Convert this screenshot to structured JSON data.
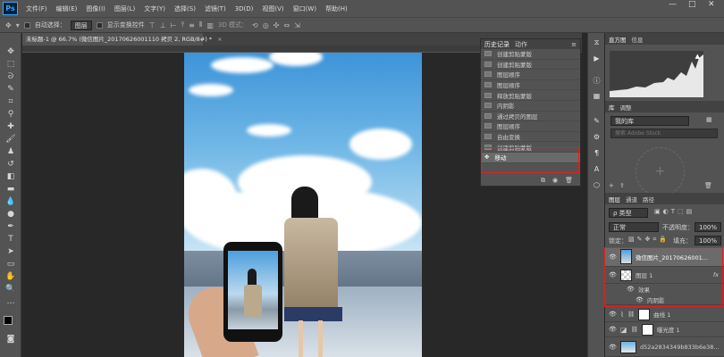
{
  "app": {
    "logo": "Ps"
  },
  "menu": [
    "文件(F)",
    "编辑(E)",
    "图像(I)",
    "图层(L)",
    "文字(Y)",
    "选择(S)",
    "滤镜(T)",
    "3D(D)",
    "视图(V)",
    "窗口(W)",
    "帮助(H)"
  ],
  "window_controls": {
    "minimize": "—",
    "maximize": "□",
    "close": "✕"
  },
  "options": {
    "auto_select_label": "自动选择：",
    "auto_select_value": "图层",
    "show_transform_label": "显示变换控件",
    "mode_3d": "3D 模式："
  },
  "document_tab": {
    "title": "未标题-1 @ 66.7% (微信图片_20170626001110 拷贝 2, RGB/8#) *",
    "close": "×"
  },
  "history_panel": {
    "tabs": [
      "历史记录",
      "动作"
    ],
    "items": [
      "创建剪贴蒙版",
      "创建剪贴蒙版",
      "图层顺序",
      "图层顺序",
      "释放剪贴蒙版",
      "内阴影",
      "通过拷贝的图层",
      "图层顺序",
      "自由变换",
      "创建剪贴蒙版",
      "移动"
    ],
    "selected_index": 10
  },
  "histogram_panel": {
    "tabs": [
      "直方图",
      "信息"
    ],
    "warning": "▲"
  },
  "library_panel": {
    "tabs": [
      "库",
      "调整"
    ],
    "dropdown": "我的库",
    "search_placeholder": "搜索 Adobe Stock"
  },
  "layers_panel": {
    "tabs": [
      "图层",
      "通道",
      "路径"
    ],
    "filter_label": "ρ 类型",
    "blend_mode": "正常",
    "opacity_label": "不透明度：",
    "opacity_value": "100%",
    "lock_label": "锁定：",
    "fill_label": "填充：",
    "fill_value": "100%",
    "layers": [
      {
        "name": "微信图片_20170626001...",
        "type": "image"
      },
      {
        "name": "图层 1",
        "type": "layer",
        "fx": "fx"
      },
      {
        "name": "效果",
        "type": "effect-group"
      },
      {
        "name": "内阴影",
        "type": "effect"
      },
      {
        "name": "曲线 1",
        "type": "adjustment"
      },
      {
        "name": "曝光度 1",
        "type": "adjustment"
      },
      {
        "name": "d52a2834349b833b6e38...",
        "type": "image"
      }
    ]
  },
  "colors": {
    "highlight_box": "#e02020",
    "panel_bg": "#535353",
    "canvas_bg": "#282828"
  }
}
